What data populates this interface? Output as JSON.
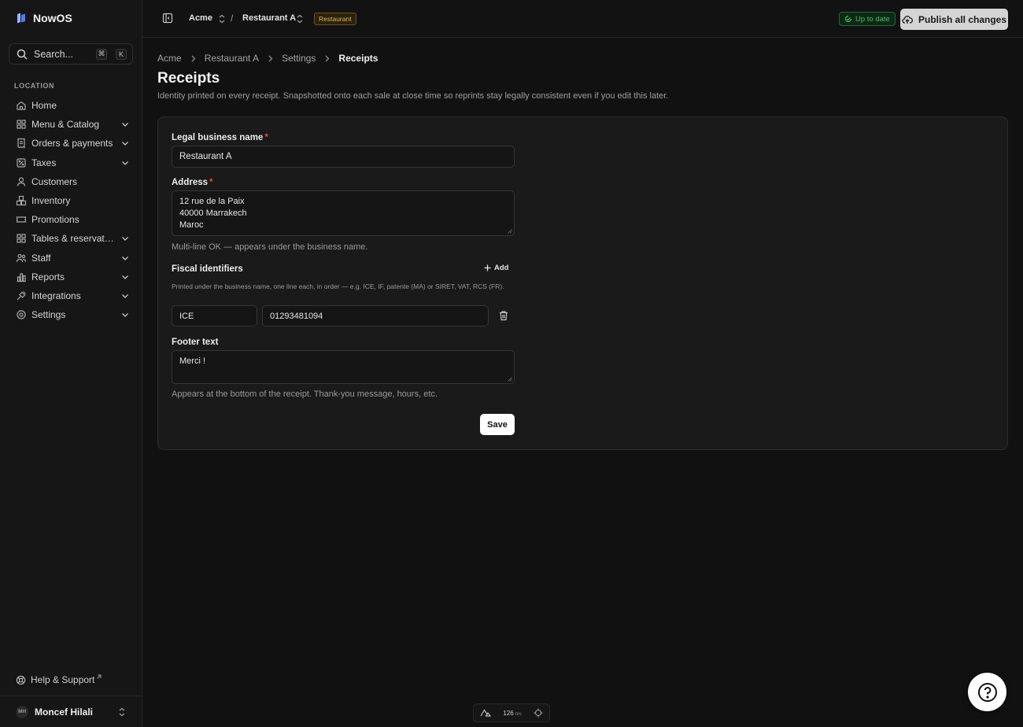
{
  "app": {
    "name": "NowOS"
  },
  "sidebar": {
    "search": {
      "label": "Search...",
      "shortcut_keys": [
        "⌘",
        "K"
      ]
    },
    "section_label": "LOCATION",
    "items": [
      {
        "label": "Home",
        "icon": "home-icon",
        "expandable": false
      },
      {
        "label": "Menu & Catalog",
        "icon": "grid-icon",
        "expandable": true
      },
      {
        "label": "Orders & payments",
        "icon": "receipt-icon",
        "expandable": true
      },
      {
        "label": "Taxes",
        "icon": "percent-icon",
        "expandable": true
      },
      {
        "label": "Customers",
        "icon": "user-icon",
        "expandable": false
      },
      {
        "label": "Inventory",
        "icon": "boxes-icon",
        "expandable": false
      },
      {
        "label": "Promotions",
        "icon": "ticket-icon",
        "expandable": false
      },
      {
        "label": "Tables & reservations",
        "icon": "layout-grid-icon",
        "expandable": true
      },
      {
        "label": "Staff",
        "icon": "users-icon",
        "expandable": true
      },
      {
        "label": "Reports",
        "icon": "bar-chart-icon",
        "expandable": true
      },
      {
        "label": "Integrations",
        "icon": "plug-icon",
        "expandable": true
      },
      {
        "label": "Settings",
        "icon": "gear-icon",
        "expandable": true
      }
    ],
    "help": {
      "label": "Help & Support"
    },
    "user": {
      "initials": "MH",
      "name": "Moncef Hilali"
    }
  },
  "topbar": {
    "org": "Acme",
    "separator": "/",
    "location": "Restaurant A",
    "location_tag": "Restaurant",
    "status": "Up to date",
    "publish_label": "Publish all changes"
  },
  "breadcrumb": [
    "Acme",
    "Restaurant A",
    "Settings",
    "Receipts"
  ],
  "page": {
    "title": "Receipts",
    "description": "Identity printed on every receipt. Snapshotted onto each sale at close time so reprints stay legally consistent even if you edit this later."
  },
  "form": {
    "business_name": {
      "label": "Legal business name",
      "required_mark": "*",
      "value": "Restaurant A"
    },
    "address": {
      "label": "Address",
      "required_mark": "*",
      "lines": [
        "12 rue de la Paix",
        "40000 Marrakech",
        "Maroc"
      ],
      "hint": "Multi-line OK — appears under the business name."
    },
    "fiscal": {
      "label": "Fiscal identifiers",
      "add_label": "Add",
      "hint": "Printed under the business name, one line each, in order — e.g. ICE, IF, patente (MA) or SIRET, VAT, RCS (FR).",
      "rows": [
        {
          "key": "ICE",
          "value": "01293481094"
        }
      ]
    },
    "footer": {
      "label": "Footer text",
      "value": "Merci !",
      "hint": "Appears at the bottom of the receipt. Thank-you message, hours, etc."
    },
    "save_label": "Save"
  },
  "perf_widget": {
    "value": "126",
    "unit": "ms"
  },
  "colors": {
    "background": "#111111",
    "status_green": "#3fc262",
    "tag_amber": "#e0b547",
    "required_red": "#e5484d"
  }
}
